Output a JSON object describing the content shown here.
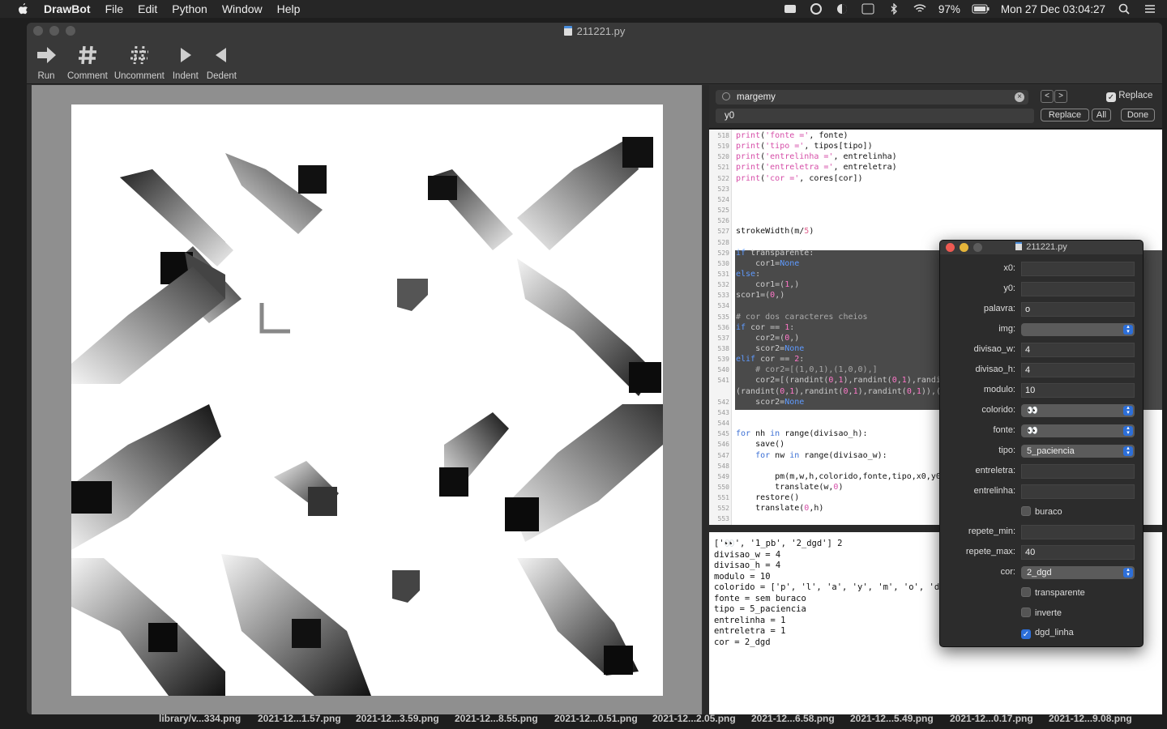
{
  "menubar": {
    "app": "DrawBot",
    "items": [
      "File",
      "Edit",
      "Python",
      "Window",
      "Help"
    ],
    "battery": "97%",
    "datetime": "Mon 27 Dec  03:04:27"
  },
  "window": {
    "title": "211221.py",
    "toolbar": [
      {
        "label": "Run",
        "icon": "run-icon"
      },
      {
        "label": "Comment",
        "icon": "hash-icon"
      },
      {
        "label": "Uncomment",
        "icon": "uncomment-icon"
      },
      {
        "label": "Indent",
        "icon": "indent-icon"
      },
      {
        "label": "Dedent",
        "icon": "dedent-icon"
      }
    ]
  },
  "find": {
    "search_value": "margemy",
    "replace_value": "y0",
    "replace_check_label": "Replace",
    "replace_check": true,
    "replace_btn": "Replace",
    "all_btn": "All",
    "done_btn": "Done"
  },
  "editor": {
    "lines": [
      {
        "n": "518",
        "html": "<span class='st'>print</span>(<span class='st'>'fonte ='</span>, fonte)"
      },
      {
        "n": "519",
        "html": "<span class='st'>print</span>(<span class='st'>'tipo ='</span>, tipos[tipo])"
      },
      {
        "n": "520",
        "html": "<span class='st'>print</span>(<span class='st'>'entrelinha ='</span>, entrelinha)"
      },
      {
        "n": "521",
        "html": "<span class='st'>print</span>(<span class='st'>'entreletra ='</span>, entreletra)"
      },
      {
        "n": "522",
        "html": "<span class='st'>print</span>(<span class='st'>'cor ='</span>, cores[cor])"
      },
      {
        "n": "523",
        "html": ""
      },
      {
        "n": "524",
        "html": ""
      },
      {
        "n": "525",
        "html": ""
      },
      {
        "n": "526",
        "html": ""
      },
      {
        "n": "527",
        "html": "strokeWidth(m/<span class='num'>5</span>)"
      },
      {
        "n": "528",
        "html": ""
      },
      {
        "n": "529",
        "html": "<span class='kw'>if</span> transparente:",
        "sel": true
      },
      {
        "n": "530",
        "html": "    cor1=<span class='kw'>None</span>",
        "sel": true
      },
      {
        "n": "531",
        "html": "<span class='kw'>else</span>:",
        "sel": true
      },
      {
        "n": "532",
        "html": "    cor1=(<span class='st'>1</span>,)",
        "sel": true
      },
      {
        "n": "533",
        "html": "scor1=(<span class='st'>0</span>,)",
        "sel": true
      },
      {
        "n": "534",
        "html": "",
        "sel": true
      },
      {
        "n": "535",
        "html": "<span class='cm'># cor dos caracteres cheios</span>",
        "sel": true
      },
      {
        "n": "536",
        "html": "<span class='kw'>if</span> cor == <span class='st'>1</span>:",
        "sel": true
      },
      {
        "n": "537",
        "html": "    cor2=(<span class='st'>0</span>,)",
        "sel": true
      },
      {
        "n": "538",
        "html": "    scor2=<span class='kw'>None</span>",
        "sel": true
      },
      {
        "n": "539",
        "html": "<span class='kw'>elif</span> cor == <span class='st'>2</span>:",
        "sel": true
      },
      {
        "n": "540",
        "html": "    <span class='cm'># cor2=[(1,0,1),(1,0,0),]</span>",
        "sel": true
      },
      {
        "n": "541",
        "html": "    cor2=[(randint(<span class='st'>0</span>,<span class='st'>1</span>),randint(<span class='st'>0</span>,<span class='st'>1</span>),randi",
        "sel": true
      },
      {
        "n": "",
        "html": "(randint(<span class='st'>0</span>,<span class='st'>1</span>),randint(<span class='st'>0</span>,<span class='st'>1</span>),randint(<span class='st'>0</span>,<span class='st'>1</span>)),(",
        "sel": true
      },
      {
        "n": "542",
        "html": "    scor2=<span class='kw'>None</span>",
        "sel": true
      },
      {
        "n": "543",
        "html": ""
      },
      {
        "n": "544",
        "html": ""
      },
      {
        "n": "545",
        "html": "<span class='kw'>for</span> nh <span class='kw'>in</span> range(divisao_h):"
      },
      {
        "n": "546",
        "html": "    save()"
      },
      {
        "n": "547",
        "html": "    <span class='kw'>for</span> nw <span class='kw'>in</span> range(divisao_w):"
      },
      {
        "n": "548",
        "html": ""
      },
      {
        "n": "549",
        "html": "        pm(m,w,h,colorido,fonte,tipo,x0,y0"
      },
      {
        "n": "550",
        "html": "        translate(w,<span class='st'>0</span>)"
      },
      {
        "n": "551",
        "html": "    restore()"
      },
      {
        "n": "552",
        "html": "    translate(<span class='st'>0</span>,h)"
      },
      {
        "n": "553",
        "html": ""
      }
    ]
  },
  "output": {
    "lines": [
      "['👀', '1_pb', '2_dgd'] 2",
      "divisao_w = 4",
      "divisao_h = 4",
      "modulo = 10",
      "colorido = ['p', 'l', 'a', 'y', 'm', 'o', 'd',",
      "fonte = sem buraco",
      "tipo = 5_paciencia",
      "entrelinha = 1",
      "entreletra = 1",
      "cor = 2_dgd"
    ]
  },
  "variables": {
    "title": "211221.py",
    "rows": [
      {
        "label": "x0:",
        "kind": "field",
        "value": ""
      },
      {
        "label": "y0:",
        "kind": "field",
        "value": ""
      },
      {
        "label": "palavra:",
        "kind": "field",
        "value": "o"
      },
      {
        "label": "img:",
        "kind": "select",
        "value": ""
      },
      {
        "label": "divisao_w:",
        "kind": "field",
        "value": "4"
      },
      {
        "label": "divisao_h:",
        "kind": "field",
        "value": "4"
      },
      {
        "label": "modulo:",
        "kind": "field",
        "value": "10"
      },
      {
        "label": "colorido:",
        "kind": "select",
        "value": "👀"
      },
      {
        "label": "fonte:",
        "kind": "select",
        "value": "👀"
      },
      {
        "label": "tipo:",
        "kind": "select",
        "value": "5_paciencia"
      },
      {
        "label": "entreletra:",
        "kind": "field",
        "value": ""
      },
      {
        "label": "entrelinha:",
        "kind": "field",
        "value": ""
      },
      {
        "label": "",
        "kind": "check",
        "value": "buraco",
        "checked": false
      },
      {
        "label": "repete_min:",
        "kind": "field",
        "value": ""
      },
      {
        "label": "repete_max:",
        "kind": "field",
        "value": "40"
      },
      {
        "label": "cor:",
        "kind": "select",
        "value": "2_dgd"
      },
      {
        "label": "",
        "kind": "check",
        "value": "transparente",
        "checked": false
      },
      {
        "label": "",
        "kind": "check",
        "value": "inverte",
        "checked": false
      },
      {
        "label": "",
        "kind": "check",
        "value": "dgd_linha",
        "checked": true
      }
    ]
  },
  "dock_files": [
    "library/v...334.png",
    "2021-12...1.57.png",
    "2021-12...3.59.png",
    "2021-12...8.55.png",
    "2021-12...0.51.png",
    "2021-12...2.05.png",
    "2021-12...6.58.png",
    "2021-12...5.49.png",
    "2021-12...0.17.png",
    "2021-12...9.08.png"
  ]
}
